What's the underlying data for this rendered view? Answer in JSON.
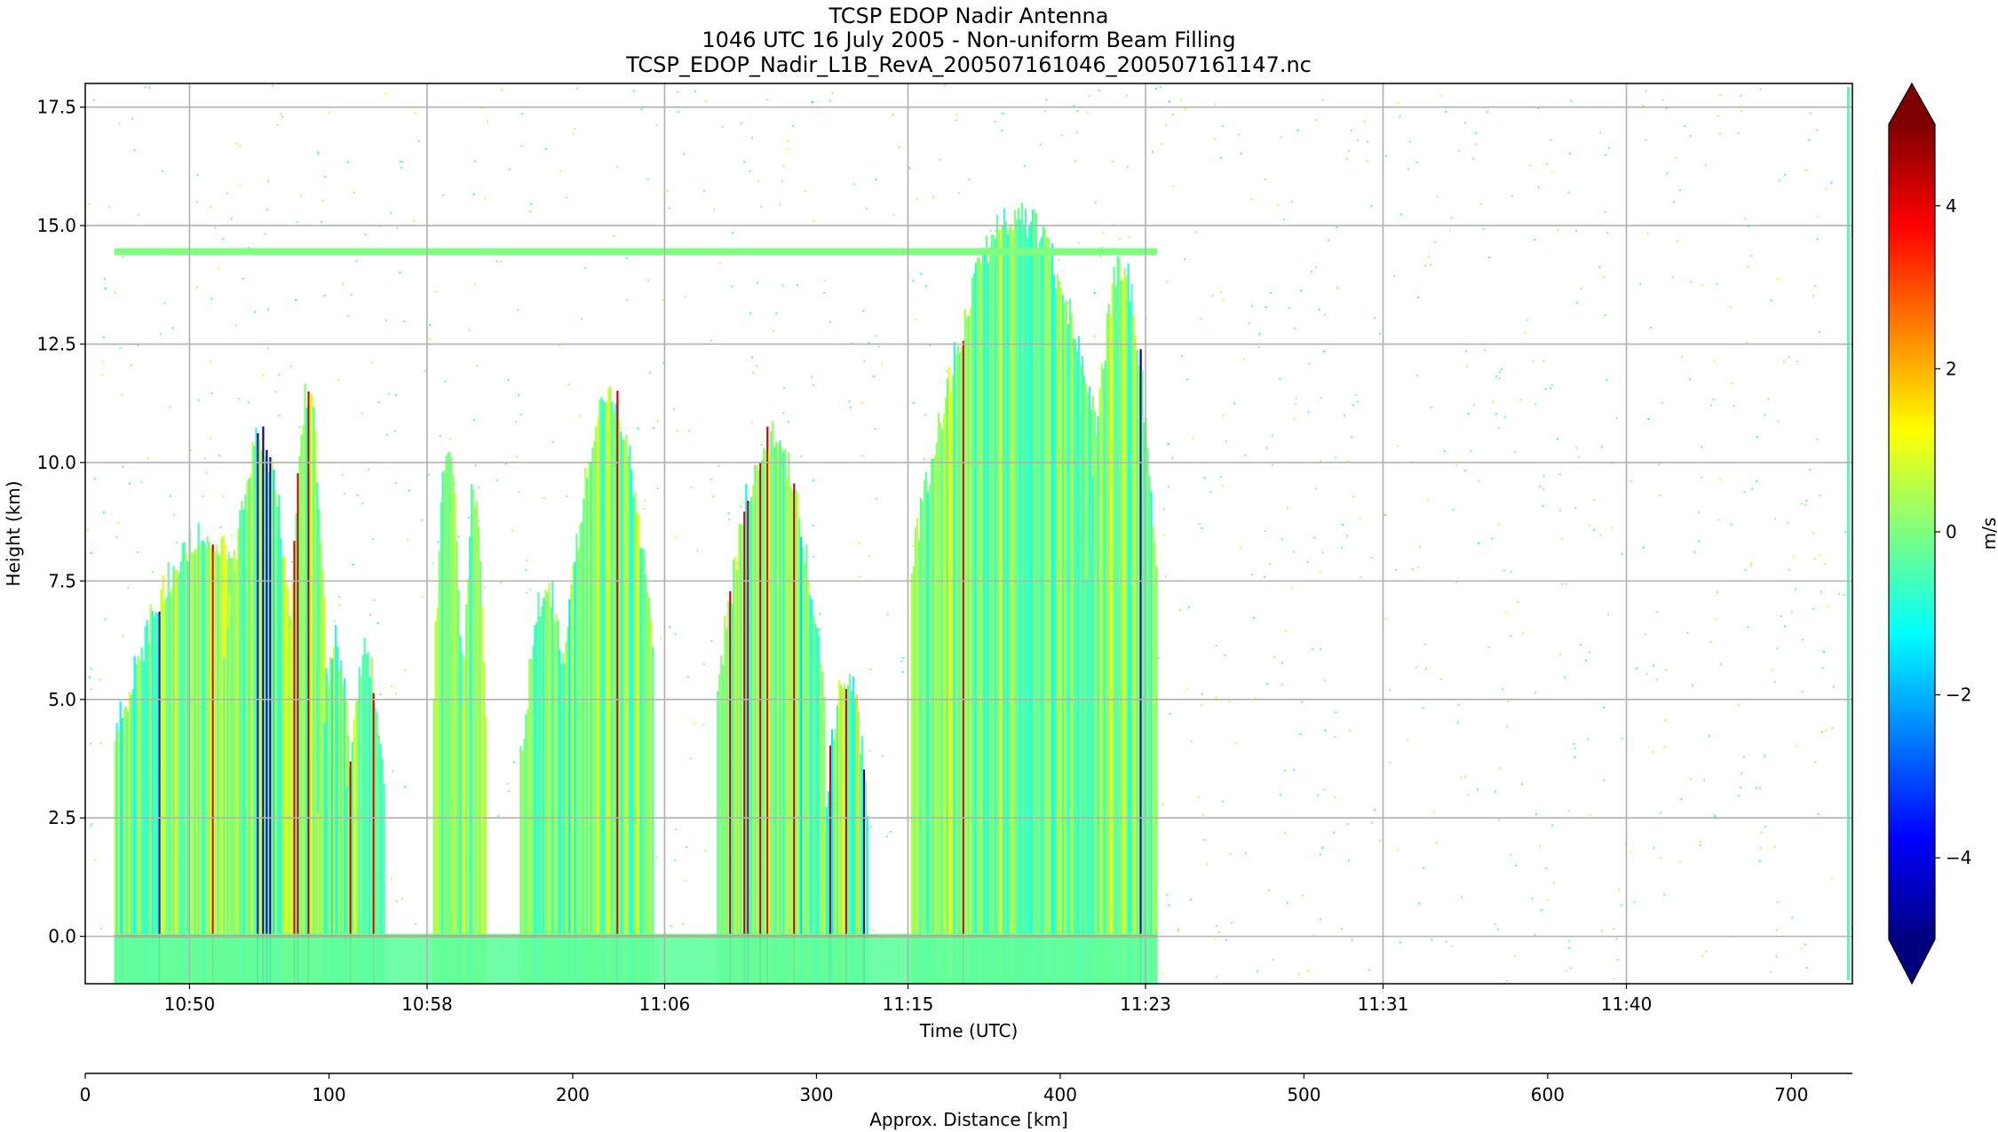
{
  "chart_data": {
    "type": "heatmap",
    "title_lines": [
      "TCSP EDOP Nadir Antenna",
      "1046 UTC 16 July 2005 - Non-uniform Beam Filling",
      "TCSP_EDOP_Nadir_L1B_RevA_200507161046_200507161147.nc"
    ],
    "xlabel": "Time (UTC)",
    "ylabel": "Height (km)",
    "ylim": [
      -1.0,
      18.0
    ],
    "yticks": [
      0.0,
      2.5,
      5.0,
      7.5,
      10.0,
      12.5,
      15.0,
      17.5
    ],
    "ytick_labels": [
      "0.0",
      "2.5",
      "5.0",
      "7.5",
      "10.0",
      "12.5",
      "15.0",
      "17.5"
    ],
    "xlim_minutes_after_1046": [
      0.0,
      61.0
    ],
    "xticks_minutes": [
      3.6,
      11.8,
      20.0,
      28.4,
      36.6,
      44.8,
      53.2
    ],
    "xtick_labels": [
      "10:50",
      "10:58",
      "11:06",
      "11:15",
      "11:23",
      "11:31",
      "11:40"
    ],
    "grid": true,
    "colorbar": {
      "label": "m/s",
      "range": [
        -5,
        5
      ],
      "ticks": [
        4,
        2,
        0,
        -2,
        -4
      ],
      "tick_labels": [
        "4",
        "2",
        "0",
        "−2",
        "−4"
      ],
      "extend": "both",
      "colormap": "jet",
      "colors": [
        "#00007f",
        "#0000ff",
        "#007fff",
        "#00ffff",
        "#7fff7f",
        "#ffff00",
        "#ff7f00",
        "#ff0000",
        "#7f0000"
      ]
    },
    "distance_axis": {
      "label": "Approx. Distance [km]",
      "ticks": [
        0,
        100,
        200,
        300,
        400,
        500,
        600,
        700
      ],
      "tick_labels": [
        "0",
        "100",
        "200",
        "300",
        "400",
        "500",
        "600",
        "700"
      ],
      "range": [
        0,
        725
      ]
    },
    "echo_columns": [
      {
        "start_min": 1.0,
        "end_min": 7.5,
        "top_km": 8.5
      },
      {
        "start_min": 4.7,
        "end_min": 7.3,
        "top_km": 10.5
      },
      {
        "start_min": 7.0,
        "end_min": 8.3,
        "top_km": 11.5
      },
      {
        "start_min": 8.0,
        "end_min": 9.2,
        "top_km": 6.2
      },
      {
        "start_min": 9.0,
        "end_min": 10.3,
        "top_km": 6.0
      },
      {
        "start_min": 12.0,
        "end_min": 13.0,
        "top_km": 10.5
      },
      {
        "start_min": 13.0,
        "end_min": 13.8,
        "top_km": 9.5
      },
      {
        "start_min": 15.0,
        "end_min": 16.8,
        "top_km": 7.4
      },
      {
        "start_min": 16.5,
        "end_min": 19.6,
        "top_km": 11.5
      },
      {
        "start_min": 21.8,
        "end_min": 25.5,
        "top_km": 10.5
      },
      {
        "start_min": 25.5,
        "end_min": 27.0,
        "top_km": 5.5
      },
      {
        "start_min": 28.5,
        "end_min": 35.8,
        "top_km": 15.2
      },
      {
        "start_min": 34.5,
        "end_min": 37.0,
        "top_km": 14.2
      }
    ],
    "aircraft_flight_level_km": 14.45,
    "aircraft_track_minutes": [
      1.0,
      37.0
    ],
    "surface_echo_km": 0.0
  }
}
